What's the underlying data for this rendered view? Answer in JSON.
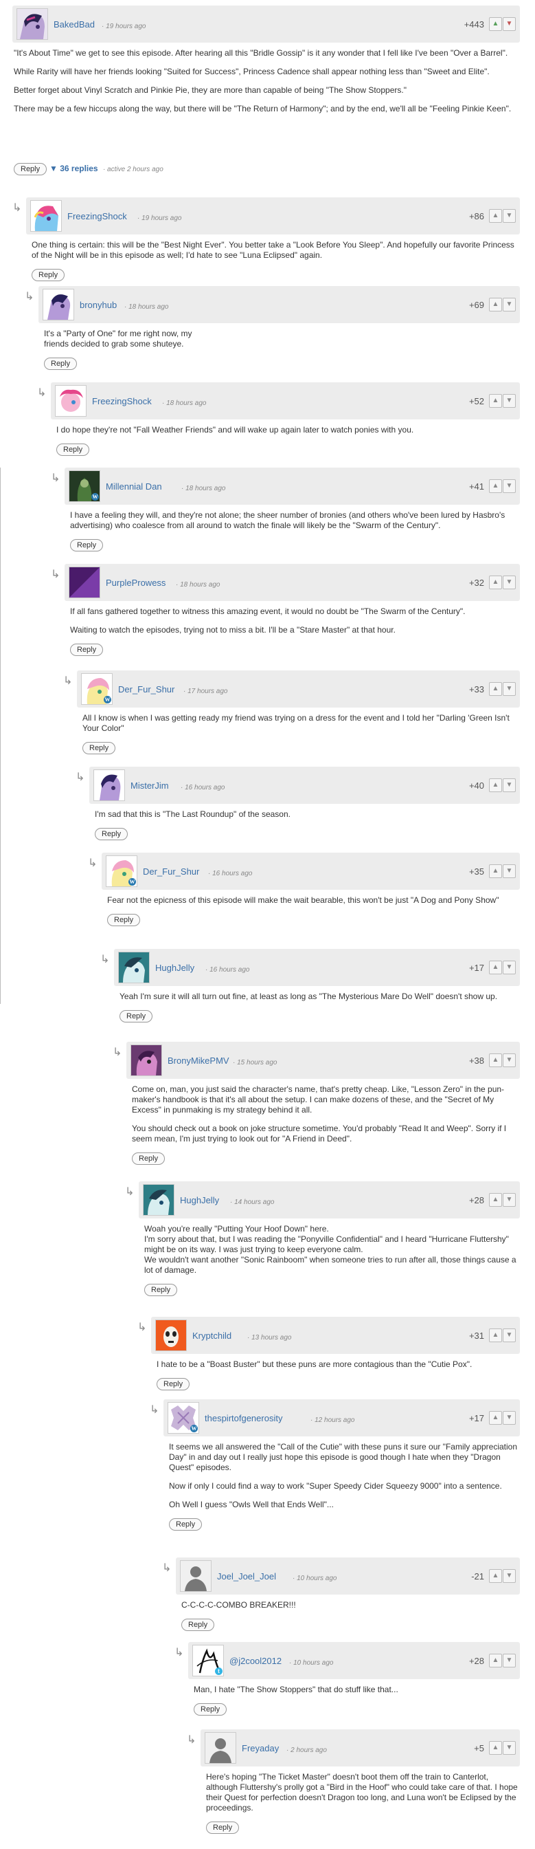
{
  "labels": {
    "reply": "Reply",
    "vote_up": "▲",
    "vote_down": "▼",
    "arrow": "↳"
  },
  "root": {
    "author": "BakedBad",
    "time": "19 hours ago",
    "score": "+443",
    "paragraphs": [
      "\"It's About Time\" we get to see this episode. After hearing all this \"Bridle Gossip\" is it any wonder that I fell like I've been \"Over a Barrel\".",
      "While Rarity will have her friends looking \"Suited for Success\", Princess Cadence shall appear nothing less than \"Sweet and Elite\".",
      "Better forget about Vinyl Scratch and Pinkie Pie, they are more than capable of being \"The Show Stoppers.\"",
      "There may be a few hiccups along the way, but there will be \"The Return of Harmony\"; and by the end, we'll all be \"Feeling Pinkie Keen\"."
    ],
    "replies_count": "▼ 36 replies",
    "activity": "· active 2 hours ago"
  },
  "comments": [
    {
      "author": "FreezingShock",
      "time": "19 hours ago",
      "score": "+86",
      "paragraphs": [
        "One thing is certain: this will be the \"Best Night Ever\". You better take a \"Look Before You Sleep\". And hopefully our favorite Princess of the Night will be in this episode as well; I'd hate to see \"Luna Eclipsed\" again."
      ]
    },
    {
      "author": "bronyhub",
      "time": "18 hours ago",
      "score": "+69",
      "paragraphs": [
        "It's a \"Party of One\" for me right now, my\nfriends decided to grab some shuteye."
      ]
    },
    {
      "author": "FreezingShock",
      "time": "18 hours ago",
      "score": "+52",
      "paragraphs": [
        "I do hope they're not \"Fall Weather Friends\" and will wake up again later to watch ponies with you."
      ]
    },
    {
      "author": "Millennial Dan",
      "time": "18 hours ago",
      "score": "+41",
      "paragraphs": [
        "I have a feeling they will, and they're not alone; the sheer number of bronies (and others who've been lured by Hasbro's advertising) who coalesce from all around to watch the finale will likely be the \"Swarm of the Century\"."
      ]
    },
    {
      "author": "PurpleProwess",
      "time": "18 hours ago",
      "score": "+32",
      "paragraphs": [
        "If all fans gathered together to witness this amazing event, it would no doubt be \"The Swarm of the Century\".",
        "Waiting to watch the episodes, trying not to miss a bit. I'll be a \"Stare Master\" at that hour."
      ]
    },
    {
      "author": "Der_Fur_Shur",
      "time": "17 hours ago",
      "score": "+33",
      "paragraphs": [
        "All I know is when I was getting ready my friend was trying on a dress for the event and I told her \"Darling 'Green Isn't Your Color\""
      ]
    },
    {
      "author": "MisterJim",
      "time": "16 hours ago",
      "score": "+40",
      "paragraphs": [
        "I'm sad that this is \"The Last Roundup\" of the season."
      ]
    },
    {
      "author": "Der_Fur_Shur",
      "time": "16 hours ago",
      "score": "+35",
      "paragraphs": [
        "Fear not the epicness of this episode will make the wait bearable, this won't be just \"A Dog and Pony Show\""
      ]
    },
    {
      "author": "HughJelly",
      "time": "16 hours ago",
      "score": "+17",
      "paragraphs": [
        "Yeah I'm sure it will all turn out fine, at least as long as \"The Mysterious Mare Do Well\" doesn't show up."
      ]
    },
    {
      "author": "BronyMikePMV",
      "time": "15 hours ago",
      "score": "+38",
      "paragraphs": [
        "Come on, man, you just said the character's name, that's pretty cheap. Like, \"Lesson Zero\" in the pun-maker's handbook is that it's all about the setup. I can make dozens of these, and the \"Secret of My Excess\" in punmaking is my strategy behind it all.",
        "You should check out a book on joke structure sometime. You'd probably \"Read It and Weep\". Sorry if I seem mean, I'm just trying to look out for \"A Friend in Deed\"."
      ]
    },
    {
      "author": "HughJelly",
      "time": "14 hours ago",
      "score": "+28",
      "paragraphs": [
        "Woah you're really \"Putting Your Hoof Down\" here.\nI'm sorry about that, but I was reading the \"Ponyville Confidential\" and I heard \"Hurricane Fluttershy\" might be on its way. I was just trying to keep everyone calm.\nWe wouldn't want another \"Sonic Rainboom\" when someone tries to run after all, those things cause a lot of damage."
      ]
    },
    {
      "author": "Kryptchild",
      "time": "13 hours ago",
      "score": "+31",
      "paragraphs": [
        "I hate to be a \"Boast Buster\" but these puns are more contagious than the \"Cutie Pox\"."
      ]
    },
    {
      "author": "thespirtofgenerosity",
      "time": "12 hours ago",
      "score": "+17",
      "paragraphs": [
        "It seems we all answered the \"Call of the Cutie\" with these puns it sure our \"Family appreciation Day\" in and day out I really just hope this episode is good though I hate when they \"Dragon Quest\" episodes.",
        "Now if only I could find a way to work \"Super Speedy Cider Squeezy 9000\" into a sentence.",
        "Oh Well I guess \"Owls Well that Ends Well\"..."
      ]
    },
    {
      "author": "Joel_Joel_Joel",
      "time": "10 hours ago",
      "score": "-21",
      "paragraphs": [
        "C-C-C-C-COMBO BREAKER!!!"
      ]
    },
    {
      "author": "@j2cool2012",
      "time": "10 hours ago",
      "score": "+28",
      "paragraphs": [
        "Man, I hate \"The Show Stoppers\" that do stuff like that..."
      ]
    },
    {
      "author": "Freyaday",
      "time": "2 hours ago",
      "score": "+5",
      "paragraphs": [
        "Here's hoping \"The Ticket Master\" doesn't boot them off the train to Canterlot, although Fluttershy's prolly got a \"Bird in the Hoof\" who could take care of that. I hope their Quest for perfection doesn't Dragon too long, and Luna won't be Eclipsed by the proceedings."
      ]
    }
  ]
}
